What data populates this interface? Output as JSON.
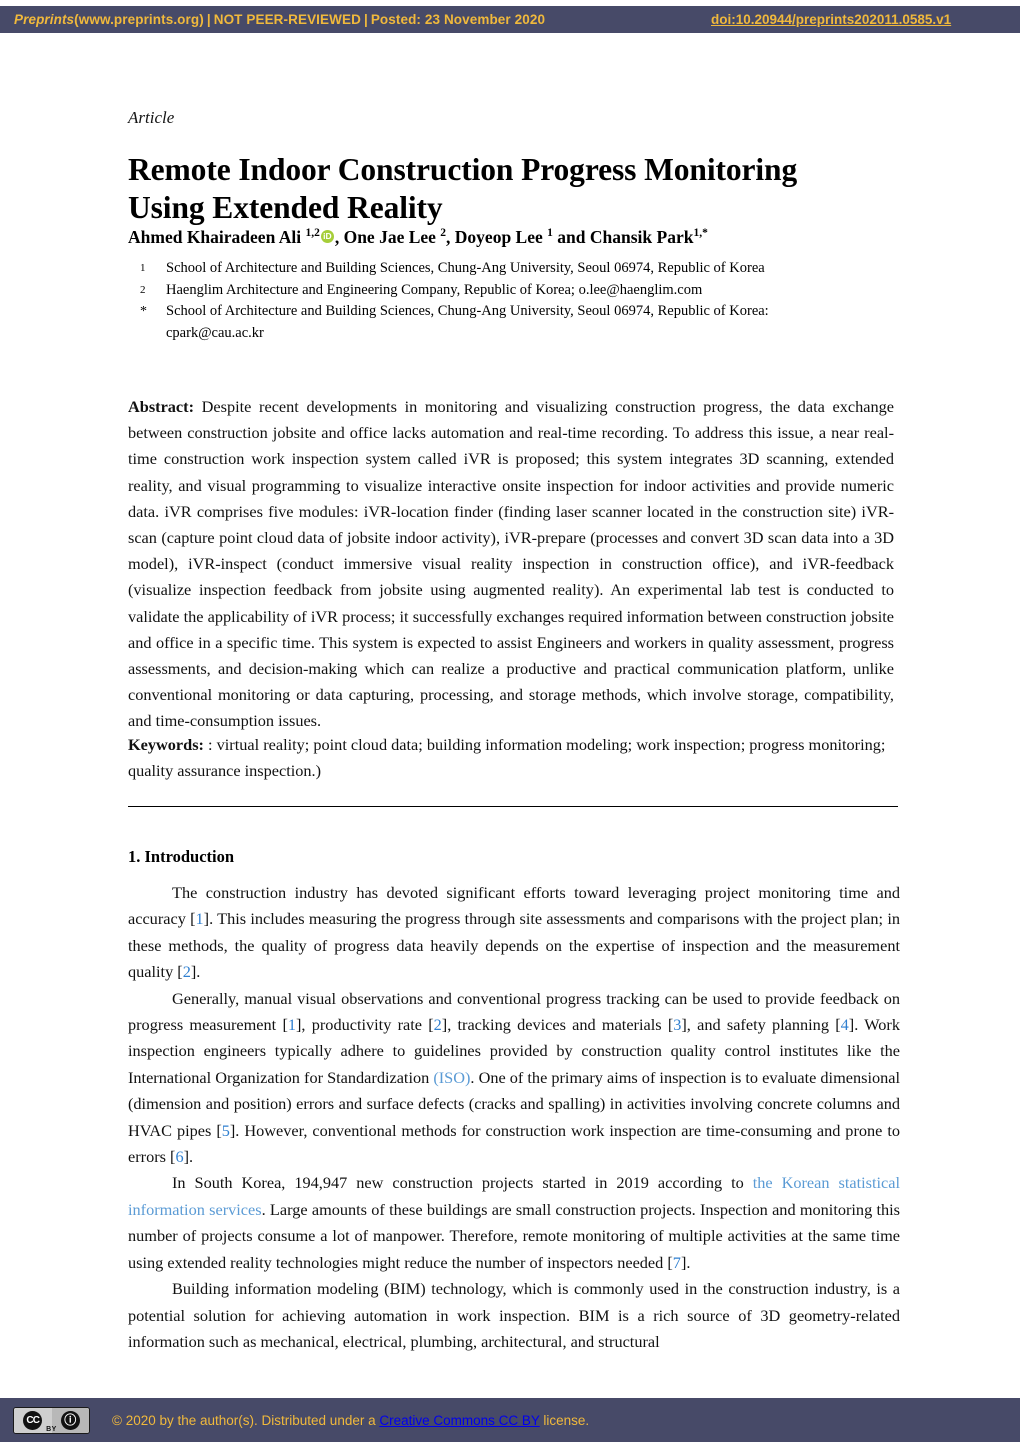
{
  "banner": {
    "brand": "Preprints",
    "site": "(www.preprints.org)",
    "separator": "|",
    "review_status": "NOT PEER-REVIEWED",
    "posted": "Posted: 23 November 2020",
    "doi": "doi:10.20944/preprints202011.0585.v1",
    "background_color": "#474a68",
    "text_color": "#f0b93c"
  },
  "article": {
    "kind": "Article",
    "title_line1": "Remote Indoor Construction Progress Monitoring",
    "title_line2": "Using Extended Reality",
    "authors_pre": "Ahmed Khairadeen Ali ",
    "author1_sup": "1,2",
    "orcid_icon": "orcid-id-icon",
    "orcid_label": "iD",
    "authors_post": ", One Jae Lee ",
    "author2_sup": "2",
    "authors_mid": ", Doyeop Lee ",
    "author3_sup": "1",
    "authors_end": " and Chansik Park",
    "author4_sup": "1,*"
  },
  "affiliations": [
    {
      "marker": "1",
      "text": "School of Architecture and Building Sciences, Chung-Ang University, Seoul 06974, Republic of Korea"
    },
    {
      "marker": "2",
      "text": "Haenglim Architecture and Engineering Company, Republic of Korea; o.lee@haenglim.com"
    },
    {
      "marker": "*",
      "text": "School of Architecture and Building Sciences, Chung-Ang University, Seoul 06974, Republic of Korea:",
      "text2": "cpark@cau.ac.kr"
    }
  ],
  "abstract": {
    "label": "Abstract:",
    "body": " Despite recent developments in monitoring and visualizing construction progress, the data exchange between construction jobsite and office lacks automation and real-time recording. To address this issue, a near real-time construction work inspection system called iVR is proposed; this system integrates 3D scanning, extended reality, and visual programming to visualize interactive onsite inspection for indoor activities and provide numeric data. iVR comprises five modules: iVR-location finder (finding laser scanner located in the construction site) iVR-scan (capture point cloud data of jobsite indoor activity), iVR-prepare (processes and convert 3D scan data into a 3D model), iVR-inspect (conduct immersive visual reality inspection in construction office), and iVR-feedback (visualize inspection feedback from jobsite using augmented reality). An experimental lab test is conducted to validate the applicability of iVR process; it successfully exchanges required information between construction jobsite and office in a specific time. This system is expected to assist Engineers and workers in quality assessment, progress assessments, and decision-making which can realize a productive and practical communication platform, unlike conventional monitoring or data capturing, processing, and storage methods, which involve storage, compatibility, and time-consumption issues."
  },
  "keywords": {
    "label": "Keywords:",
    "body": " :  virtual reality; point cloud data; building information modeling; work inspection; progress monitoring; quality assurance inspection.)"
  },
  "introduction": {
    "heading": "1. Introduction",
    "p1_a": "The construction industry has devoted significant efforts toward leveraging project monitoring time and accuracy [",
    "p1_ref1": "1",
    "p1_b": "]. This includes measuring the progress through site assessments and comparisons with the project plan; in these methods, the quality of progress data heavily depends on the expertise of inspection and the measurement quality [",
    "p1_ref2": "2",
    "p1_c": "].",
    "p2_a": "Generally, manual visual observations and conventional progress tracking can be used to provide feedback on progress measurement [",
    "p2_ref1": "1",
    "p2_b": "], productivity rate [",
    "p2_ref2": "2",
    "p2_c": "], tracking devices and materials [",
    "p2_ref3": "3",
    "p2_d": "], and safety planning [",
    "p2_ref4": "4",
    "p2_e": "]. Work inspection engineers typically adhere to guidelines provided by construction quality control institutes like the International Organization for Standardization ",
    "p2_link_iso": "(ISO)",
    "p2_f": ". One of the primary aims of inspection is to evaluate dimensional (dimension and position) errors and surface defects (cracks and spalling) in activities involving concrete columns and HVAC pipes [",
    "p2_ref5": "5",
    "p2_g": "]. However, conventional methods for construction work inspection are time-consuming and prone to errors [",
    "p2_ref6": "6",
    "p2_h": "].",
    "p3_a": "In South Korea, 194,947 new construction projects started in 2019 according to ",
    "p3_link": "the Korean statistical information services",
    "p3_b": ". Large amounts of these buildings are small construction projects. Inspection and monitoring this number of projects consume a lot of manpower. Therefore, remote monitoring of multiple activities at the same time using extended reality technologies might reduce the number of inspectors needed [",
    "p3_ref7": "7",
    "p3_c": "].",
    "p4": "Building information modeling (BIM) technology, which is commonly used in the construction industry, is a potential solution for achieving automation in work inspection. BIM is a rich source of 3D geometry-related information such as mechanical, electrical, plumbing, architectural, and structural"
  },
  "footer": {
    "cc_icon": "creative-commons-icon",
    "cc_mark": "CC",
    "by_mark": "ⓘ",
    "by_label": "BY",
    "copyright": "©  2020 by the author(s). Distributed under a ",
    "license_link": "Creative Commons CC BY",
    "license_suffix": " license.",
    "background_color": "#474a68",
    "text_color": "#f0b93c"
  }
}
